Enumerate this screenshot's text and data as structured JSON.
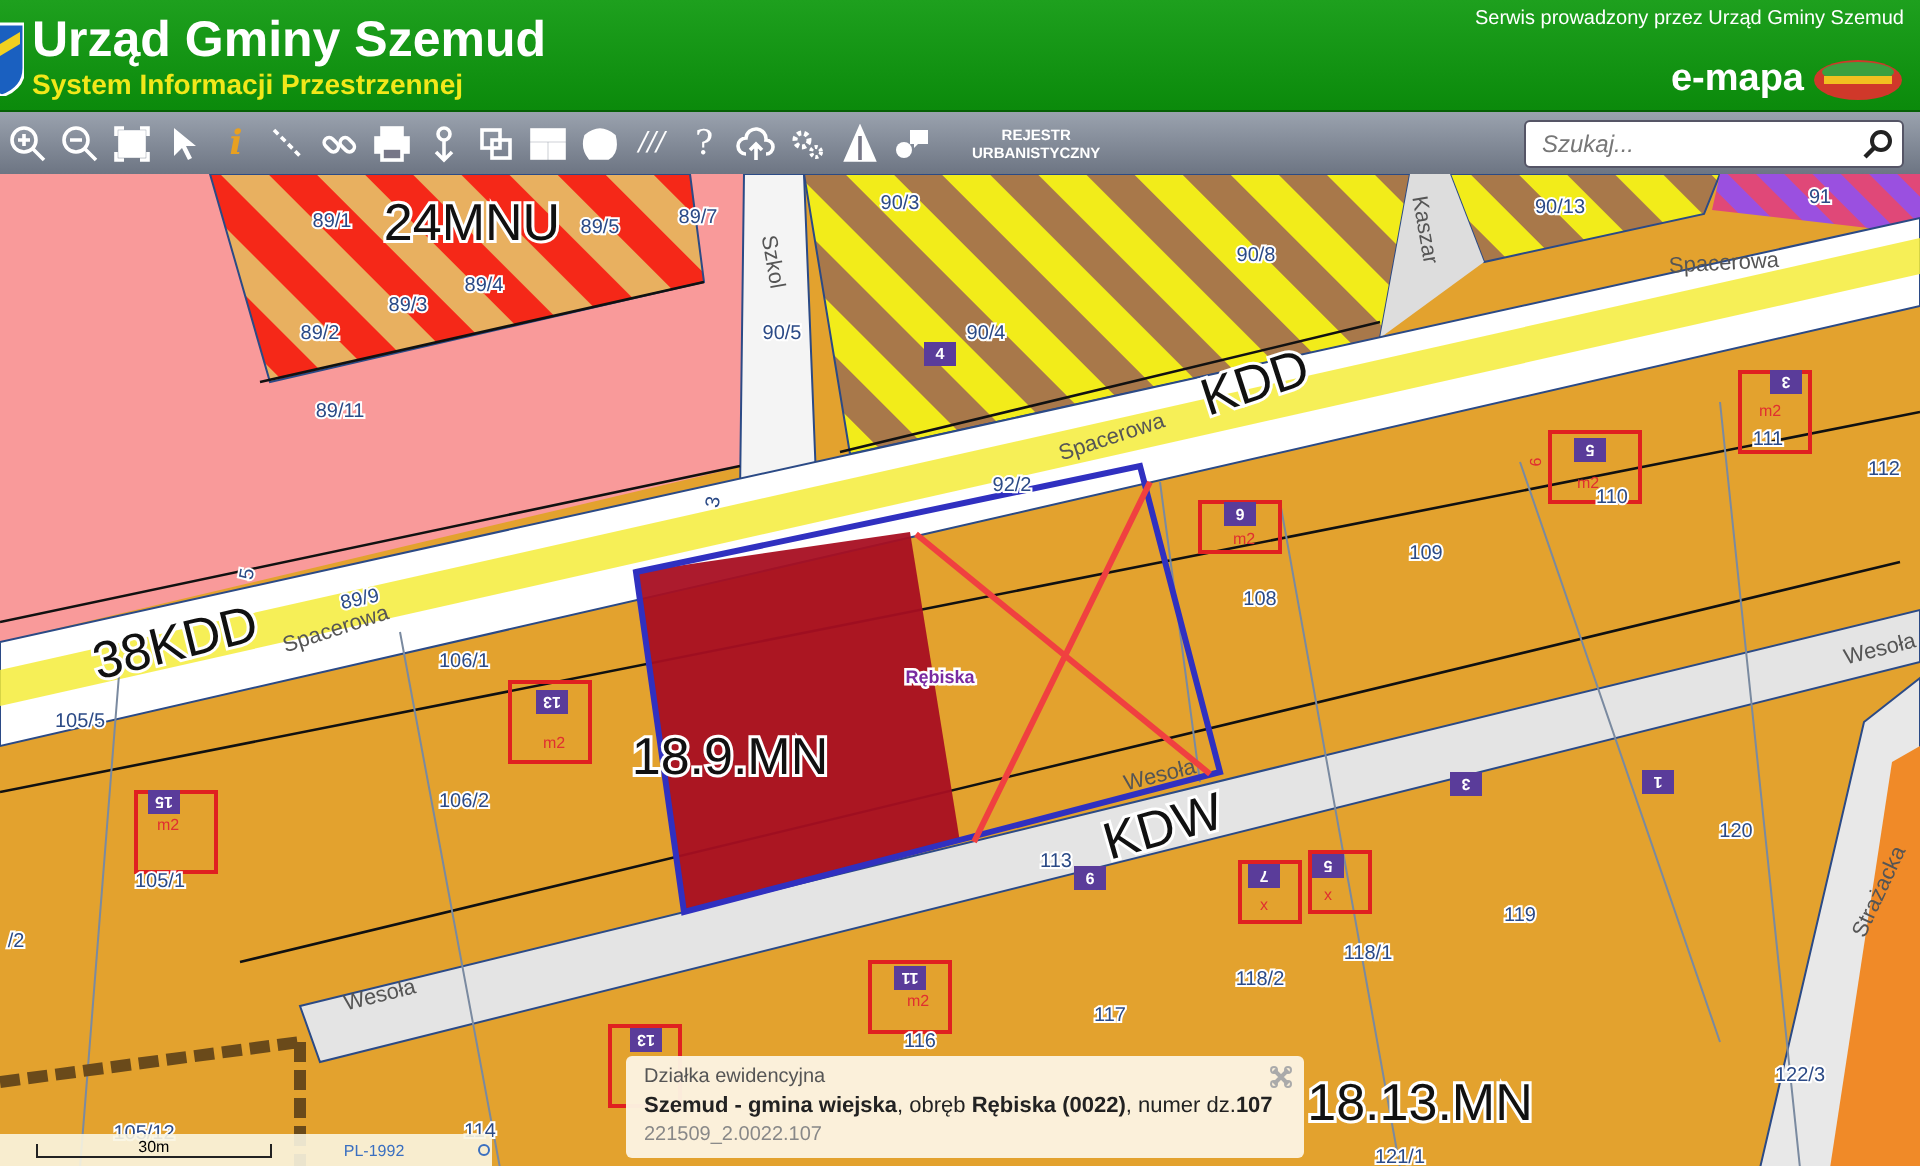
{
  "header": {
    "title": "Urząd Gminy Szemud",
    "subtitle": "System Informacji Przestrzennej",
    "provider": "Serwis prowadzony przez Urząd Gminy Szemud",
    "brand": "e-mapa"
  },
  "toolbar": {
    "tools": [
      {
        "kind": "zoom-in"
      },
      {
        "kind": "zoom-out"
      },
      {
        "kind": "extent"
      },
      {
        "kind": "pointer"
      },
      {
        "kind": "info",
        "glyph": "i"
      },
      {
        "kind": "measure"
      },
      {
        "kind": "link"
      },
      {
        "kind": "print"
      },
      {
        "kind": "marker"
      },
      {
        "kind": "layers"
      },
      {
        "kind": "layout"
      },
      {
        "kind": "shape"
      },
      {
        "kind": "hatch",
        "glyph": "///"
      },
      {
        "kind": "help",
        "glyph": "?"
      },
      {
        "kind": "cloud"
      },
      {
        "kind": "gears"
      },
      {
        "kind": "tent"
      },
      {
        "kind": "chat"
      }
    ],
    "register_button": {
      "line1": "REJESTR",
      "line2": "URBANISTYCZNY"
    },
    "search": {
      "placeholder": "Szukaj..."
    }
  },
  "map": {
    "labels": [
      {
        "text": "89/1",
        "kind": "parcel"
      },
      {
        "text": "24MNU",
        "kind": "zone"
      },
      {
        "text": "89/5",
        "kind": "parcel"
      },
      {
        "text": "89/7",
        "kind": "parcel"
      },
      {
        "text": "89/2",
        "kind": "parcel"
      },
      {
        "text": "89/3",
        "kind": "parcel"
      },
      {
        "text": "89/4",
        "kind": "parcel"
      },
      {
        "text": "89/11",
        "kind": "parcel"
      },
      {
        "text": "Szkol",
        "kind": "street"
      },
      {
        "text": "90/3",
        "kind": "parcel"
      },
      {
        "text": "90/5",
        "kind": "parcel"
      },
      {
        "text": "90/8",
        "kind": "parcel"
      },
      {
        "text": "90/4",
        "kind": "parcel"
      },
      {
        "text": "Kaszar",
        "kind": "street"
      },
      {
        "text": "90/13",
        "kind": "parcel"
      },
      {
        "text": "91",
        "kind": "parcel"
      },
      {
        "text": "Spacerowa",
        "kind": "street"
      },
      {
        "text": "Spacerowa",
        "kind": "street"
      },
      {
        "text": "KDD",
        "kind": "zone"
      },
      {
        "text": "92/2",
        "kind": "parcel"
      },
      {
        "text": "5",
        "kind": "parcel"
      },
      {
        "text": "3",
        "kind": "parcel"
      },
      {
        "text": "89/9",
        "kind": "parcel"
      },
      {
        "text": "38KDD",
        "kind": "zone"
      },
      {
        "text": "Spacerowa",
        "kind": "street"
      },
      {
        "text": "106/1",
        "kind": "parcel"
      },
      {
        "text": "105/5",
        "kind": "parcel"
      },
      {
        "text": "108",
        "kind": "parcel"
      },
      {
        "text": "109",
        "kind": "parcel"
      },
      {
        "text": "110",
        "kind": "parcel"
      },
      {
        "text": "111",
        "kind": "parcel"
      },
      {
        "text": "112",
        "kind": "parcel"
      },
      {
        "text": "Wesoła",
        "kind": "street"
      },
      {
        "text": "Rębiska",
        "kind": "place"
      },
      {
        "text": "18.9.MN",
        "kind": "zone"
      },
      {
        "text": "106/2",
        "kind": "parcel"
      },
      {
        "text": "105/1",
        "kind": "parcel"
      },
      {
        "text": "/2",
        "kind": "parcel"
      },
      {
        "text": "Wesoła",
        "kind": "street"
      },
      {
        "text": "KDW",
        "kind": "zone"
      },
      {
        "text": "113",
        "kind": "parcel"
      },
      {
        "text": "120",
        "kind": "parcel"
      },
      {
        "text": "Strażacka",
        "kind": "street"
      },
      {
        "text": "119",
        "kind": "parcel"
      },
      {
        "text": "118/2",
        "kind": "parcel"
      },
      {
        "text": "118/1",
        "kind": "parcel"
      },
      {
        "text": "Wesoła",
        "kind": "street"
      },
      {
        "text": "117",
        "kind": "parcel"
      },
      {
        "text": "116",
        "kind": "parcel"
      },
      {
        "text": "122/3",
        "kind": "parcel"
      },
      {
        "text": "121/1",
        "kind": "parcel"
      },
      {
        "text": "114",
        "kind": "parcel"
      },
      {
        "text": "105/12",
        "kind": "parcel"
      },
      {
        "text": "18.13.MN",
        "kind": "zone"
      },
      {
        "text": "4",
        "kind": "badge"
      },
      {
        "text": "6",
        "kind": "badge"
      },
      {
        "text": "5",
        "kind": "badge"
      },
      {
        "text": "3",
        "kind": "badge"
      },
      {
        "text": "13",
        "kind": "badge"
      },
      {
        "text": "15",
        "kind": "badge"
      },
      {
        "text": "3",
        "kind": "badge"
      },
      {
        "text": "1",
        "kind": "badge"
      },
      {
        "text": "9",
        "kind": "badge"
      },
      {
        "text": "7",
        "kind": "badge"
      },
      {
        "text": "5",
        "kind": "badge"
      },
      {
        "text": "11",
        "kind": "badge"
      },
      {
        "text": "13",
        "kind": "badge"
      },
      {
        "text": "m2",
        "kind": "symbol"
      },
      {
        "text": "m2",
        "kind": "symbol"
      },
      {
        "text": "m2",
        "kind": "symbol"
      },
      {
        "text": "m2",
        "kind": "symbol"
      },
      {
        "text": "m2",
        "kind": "symbol"
      },
      {
        "text": "m2",
        "kind": "symbol"
      },
      {
        "text": "9",
        "kind": "symbol"
      },
      {
        "text": "x",
        "kind": "symbol"
      },
      {
        "text": "x",
        "kind": "symbol"
      }
    ]
  },
  "scale": {
    "distance": "30m",
    "crs": "PL-1992"
  },
  "popup": {
    "title": "Działka ewidencyjna",
    "description": "**Szemud - gmina wiejska**, obręb **Rębiska (0022)**, numer dz.**107**",
    "identifier": "221509_2.0022.107"
  }
}
